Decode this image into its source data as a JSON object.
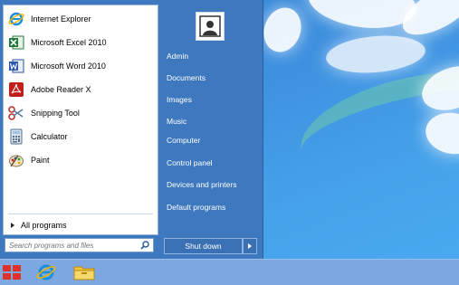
{
  "start_menu": {
    "programs": [
      {
        "label": "Internet Explorer",
        "icon": "internet-explorer-icon"
      },
      {
        "label": "Microsoft Excel 2010",
        "icon": "excel-icon"
      },
      {
        "label": "Microsoft Word 2010",
        "icon": "word-icon"
      },
      {
        "label": "Adobe Reader X",
        "icon": "adobe-reader-icon"
      },
      {
        "label": "Snipping Tool",
        "icon": "scissors-icon"
      },
      {
        "label": "Calculator",
        "icon": "calculator-icon"
      },
      {
        "label": "Paint",
        "icon": "paint-palette-icon"
      }
    ],
    "all_programs": "All programs",
    "search_placeholder": "Search programs and files",
    "right_items": [
      "Admin",
      "Documents",
      "Images",
      "Music",
      "Computer",
      "Control panel",
      "Devices and printers",
      "Default programs"
    ],
    "shutdown_label": "Shut down"
  },
  "taskbar": {
    "items": [
      "start-logo-icon",
      "internet-explorer-icon",
      "file-explorer-icon"
    ]
  },
  "colors": {
    "menu_bg": "#3e78be",
    "taskbar_bg": "#7ca7e0",
    "desktop_sky": "#3d8fdf"
  }
}
